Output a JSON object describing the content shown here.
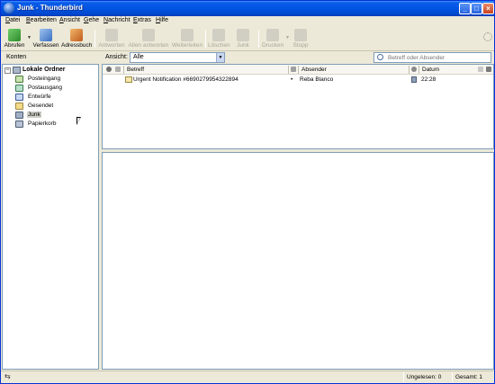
{
  "window": {
    "title": "Junk - Thunderbird"
  },
  "menu": [
    "Datei",
    "Bearbeiten",
    "Ansicht",
    "Gehe",
    "Nachricht",
    "Extras",
    "Hilfe"
  ],
  "toolbar": {
    "abrufen": "Abrufen",
    "verfassen": "Verfassen",
    "adressbuch": "Adressbuch",
    "antworten": "Antworten",
    "allen_antworten": "Allen antworten",
    "weiterleiten": "Weiterleiten",
    "loeschen": "Löschen",
    "junk": "Junk",
    "drucken": "Drucken",
    "stopp": "Stopp"
  },
  "filterbar": {
    "konten": "Konten",
    "ansicht_label": "Ansicht:",
    "ansicht_value": "Alle",
    "search_placeholder": "Betreff oder Absender"
  },
  "folders": {
    "root": "Lokale Ordner",
    "items": [
      {
        "label": "Posteingang",
        "icon": "inbox-icon"
      },
      {
        "label": "Postausgang",
        "icon": "outbox-icon"
      },
      {
        "label": "Entwürfe",
        "icon": "drafts-icon"
      },
      {
        "label": "Gesendet",
        "icon": "sent-icon"
      },
      {
        "label": "Junk",
        "icon": "junk-folder-icon",
        "selected": true
      },
      {
        "label": "Papierkorb",
        "icon": "trash-icon"
      }
    ]
  },
  "threadpane": {
    "columns": {
      "subject": "Betreff",
      "sender": "Absender",
      "date": "Datum"
    },
    "messages": [
      {
        "subject": "Urgent Notification #6690279954322894",
        "sender": "Reba Blanco",
        "date": "22:28",
        "junk": true
      }
    ]
  },
  "status": {
    "unread": "Ungelesen: 0",
    "total": "Gesamt: 1"
  },
  "colors": {
    "titlebar": "#0054e3",
    "chrome": "#ece9d8",
    "border": "#7f9db9"
  }
}
